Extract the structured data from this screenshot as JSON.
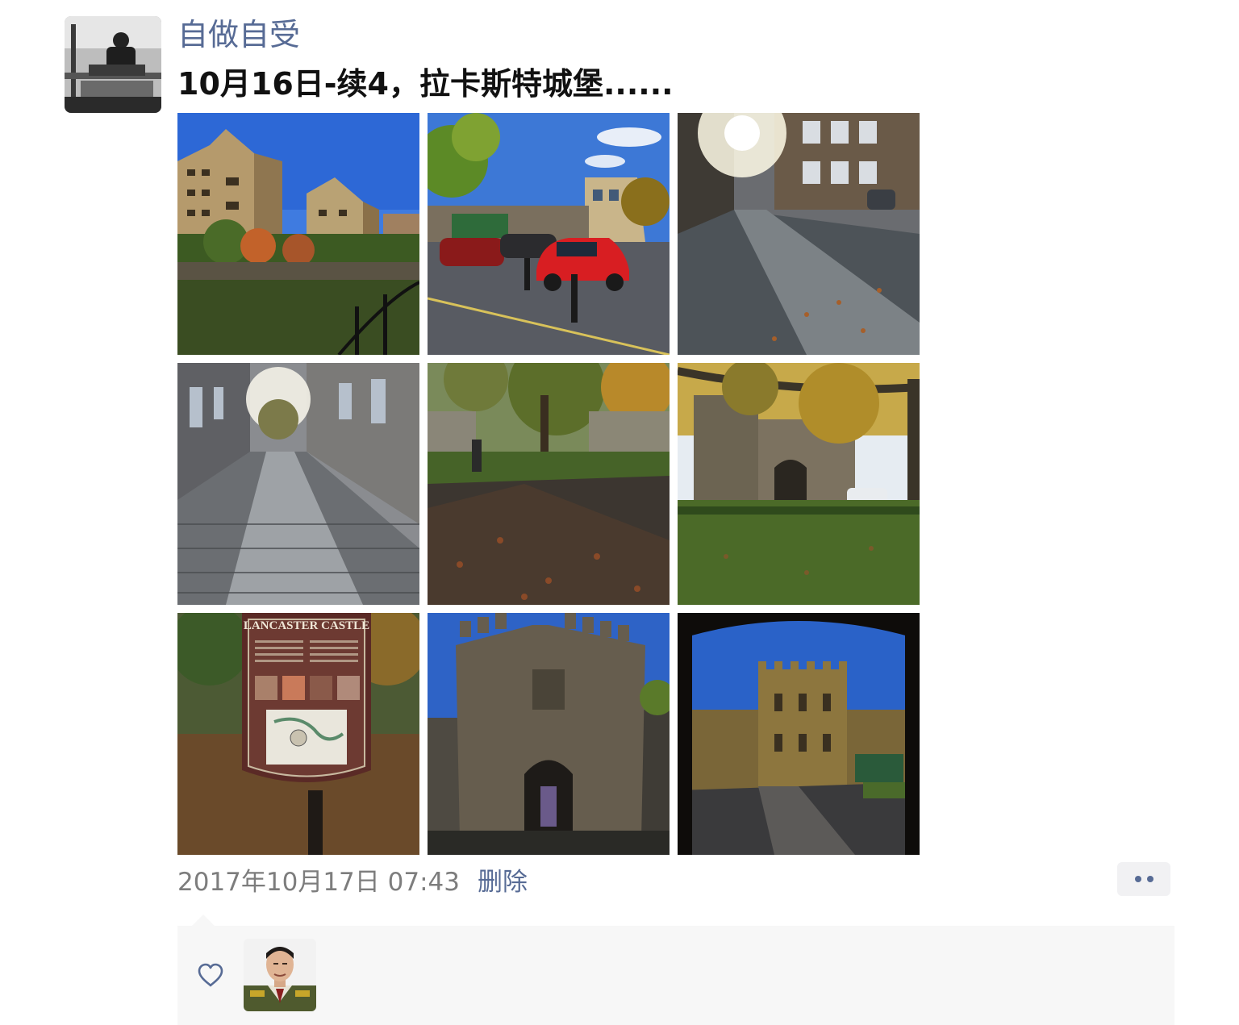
{
  "post": {
    "author": "自做自受",
    "text": "10月16日-续4，拉卡斯特城堡......",
    "timestamp": "2017年10月17日 07:43",
    "delete_label": "删除"
  },
  "photos": [
    {
      "name": "photo-apartment-buildings"
    },
    {
      "name": "photo-street-red-car"
    },
    {
      "name": "photo-cobbled-lane-sunlight"
    },
    {
      "name": "photo-cobbled-alley"
    },
    {
      "name": "photo-leafy-path-wall"
    },
    {
      "name": "photo-castle-wall-tree"
    },
    {
      "name": "photo-lancaster-castle-sign",
      "sign_text": "LANCASTER CASTLE"
    },
    {
      "name": "photo-castle-gatehouse"
    },
    {
      "name": "photo-castle-courtyard"
    }
  ],
  "icons": {
    "more": "more-icon",
    "like": "heart-icon"
  },
  "colors": {
    "link": "#576b95",
    "likes_background": "#f7f7f7"
  }
}
